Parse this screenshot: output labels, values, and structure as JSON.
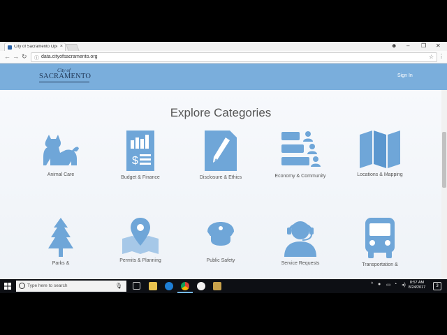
{
  "browser": {
    "tab_title": "City of Sacramento Ope",
    "tab_close": "×",
    "url": "data.cityofsacramento.org",
    "back": "←",
    "forward": "→",
    "reload": "↻",
    "star": "☆",
    "menu": "⋮",
    "win_min": "–",
    "win_max": "❐",
    "win_close": "✕",
    "profile": "☻"
  },
  "site": {
    "logo_cityof": "City of",
    "logo_name": "SACRAMENTO",
    "signin": "Sign In",
    "heading": "Explore Categories",
    "icon_color": "#6fa6d8",
    "header_color": "#7aaedc",
    "categories": [
      {
        "label": "Animal Care",
        "icon": "animal-icon"
      },
      {
        "label": "Budget & Finance",
        "icon": "budget-report-icon"
      },
      {
        "label": "Disclosure & Ethics",
        "icon": "document-pen-icon"
      },
      {
        "label": "Economy & Community",
        "icon": "people-bars-icon"
      },
      {
        "label": "Locations & Mapping",
        "icon": "folded-map-icon"
      },
      {
        "label": "Parks &",
        "icon": "tree-icon"
      },
      {
        "label": "Permits & Planning",
        "icon": "map-pin-icon"
      },
      {
        "label": "Public Safety",
        "icon": "police-cap-icon"
      },
      {
        "label": "Service Requests",
        "icon": "headset-agent-icon"
      },
      {
        "label": "Transportation &",
        "icon": "bus-icon"
      }
    ]
  },
  "taskbar": {
    "search_placeholder": "Type here to search",
    "time": "8:57 AM",
    "date": "8/24/2017",
    "notification_count": "3"
  }
}
